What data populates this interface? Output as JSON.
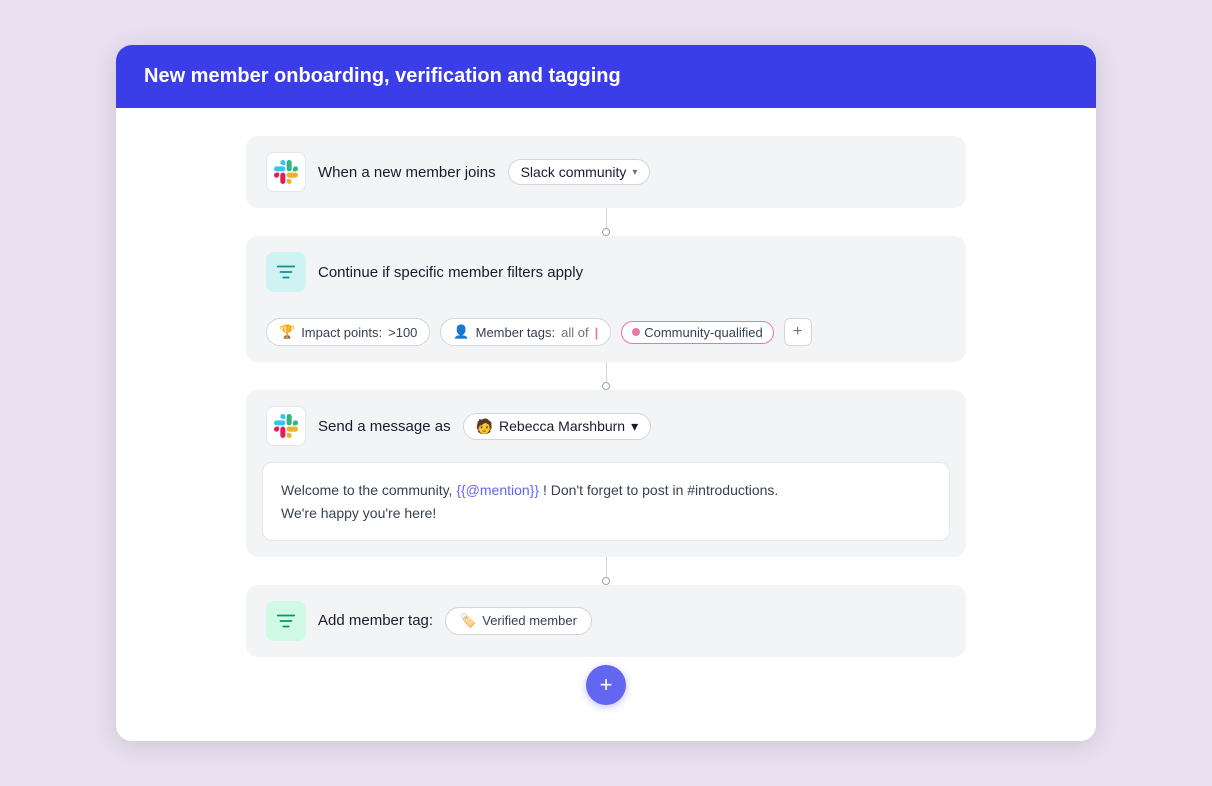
{
  "header": {
    "title": "New member onboarding, verification and tagging",
    "bg_color": "#3b3de8"
  },
  "blocks": {
    "block1": {
      "label": "When a new member joins",
      "dropdown": "Slack community"
    },
    "block2": {
      "label": "Continue if specific member filters apply",
      "filter1_label": "Impact points:",
      "filter1_value": ">100",
      "filter2_label": "Member tags:",
      "filter2_qualifier": "all of",
      "filter2_tag": "Community-qualified"
    },
    "block3": {
      "label": "Send a message as",
      "person": "Rebecca Marshburn",
      "message_line1": "Welcome to the community, {{@mention}} ! Don't forget to post in #introductions.",
      "message_line2": "We're happy you're here!",
      "mention_text": "{{@mention}}"
    },
    "block4": {
      "label": "Add member tag:",
      "tag": "Verified member"
    }
  },
  "add_button_label": "+",
  "icons": {
    "slack": "slack-icon",
    "filter": "filter-icon",
    "chevron_down": "▾",
    "plus": "+",
    "tag": "tag-icon"
  }
}
